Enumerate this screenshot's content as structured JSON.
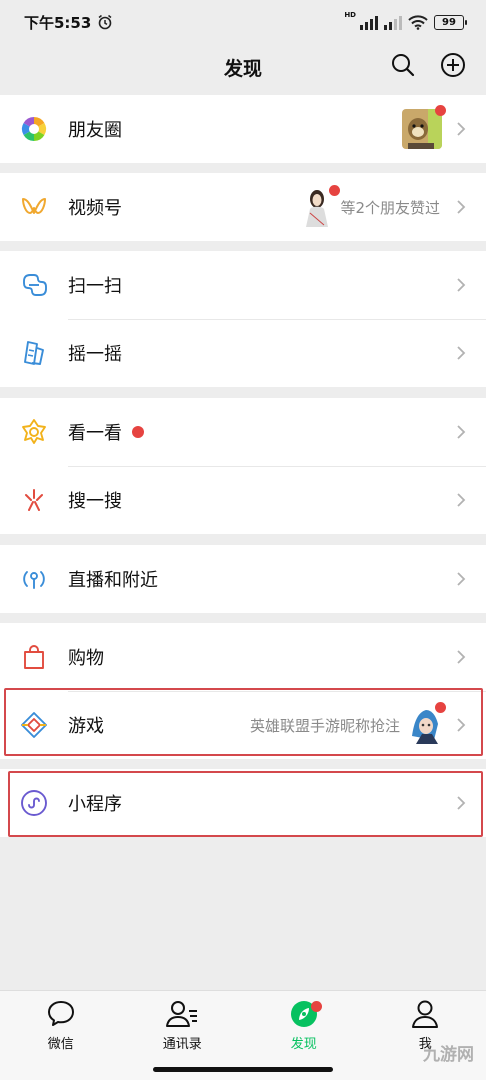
{
  "status_bar": {
    "time": "下午5:53",
    "network_label": "HD",
    "battery": "99"
  },
  "header": {
    "title": "发现",
    "actions": [
      "search-icon",
      "add-icon"
    ]
  },
  "list": {
    "moments": {
      "label": "朋友圈",
      "icon": "moments-icon",
      "has_unread_dot": true
    },
    "channels": {
      "label": "视频号",
      "meta": "等2个朋友赞过",
      "icon": "channels-icon",
      "has_unread_dot": true
    },
    "scan": {
      "label": "扫一扫",
      "icon": "scan-icon"
    },
    "shake": {
      "label": "摇一摇",
      "icon": "shake-icon"
    },
    "top_stories": {
      "label": "看一看",
      "icon": "top-stories-icon",
      "has_unread_dot": true
    },
    "search": {
      "label": "搜一搜",
      "icon": "search-spark-icon"
    },
    "live_nearby": {
      "label": "直播和附近",
      "icon": "live-nearby-icon"
    },
    "shopping": {
      "label": "购物",
      "icon": "shopping-bag-icon"
    },
    "games": {
      "label": "游戏",
      "meta": "英雄联盟手游昵称抢注",
      "icon": "games-icon",
      "has_unread_dot": true
    },
    "mini_programs": {
      "label": "小程序",
      "icon": "mini-program-icon"
    }
  },
  "tabbar": {
    "tabs": [
      {
        "label": "微信",
        "icon": "chat-bubble-icon"
      },
      {
        "label": "通讯录",
        "icon": "contacts-icon"
      },
      {
        "label": "发现",
        "icon": "compass-icon",
        "active": true,
        "has_unread_dot": true
      },
      {
        "label": "我",
        "icon": "person-icon"
      }
    ]
  },
  "watermark": "九游网",
  "colors": {
    "accent": "#07c160",
    "badge": "#e64340",
    "highlight_border": "#d4484c",
    "background": "#ededed"
  }
}
